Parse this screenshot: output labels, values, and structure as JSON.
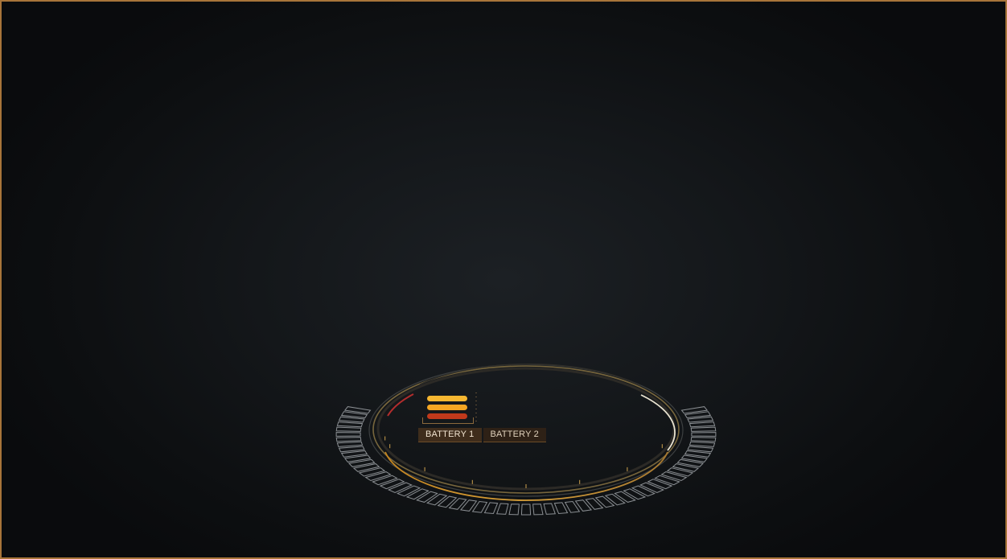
{
  "colors": {
    "border": "#a8753a",
    "accent_orange": "#f5a623",
    "accent_dark_orange": "#c0391b",
    "ring_gold": "#b58a3c",
    "ring_white": "#d8d3c4",
    "segment_gray": "#8b8f93",
    "warning_red": "#b32d2d"
  },
  "battery_panel": {
    "tabs": [
      {
        "label": "BATTERY 1",
        "active": true
      },
      {
        "label": "BATTERY 2",
        "active": false
      }
    ],
    "level_bars": [
      {
        "color": "#f7b731"
      },
      {
        "color": "#f5a623"
      },
      {
        "color": "#c0391b"
      }
    ]
  },
  "gauge": {
    "outer_segment_count": 96,
    "major_tick_count": 8
  }
}
